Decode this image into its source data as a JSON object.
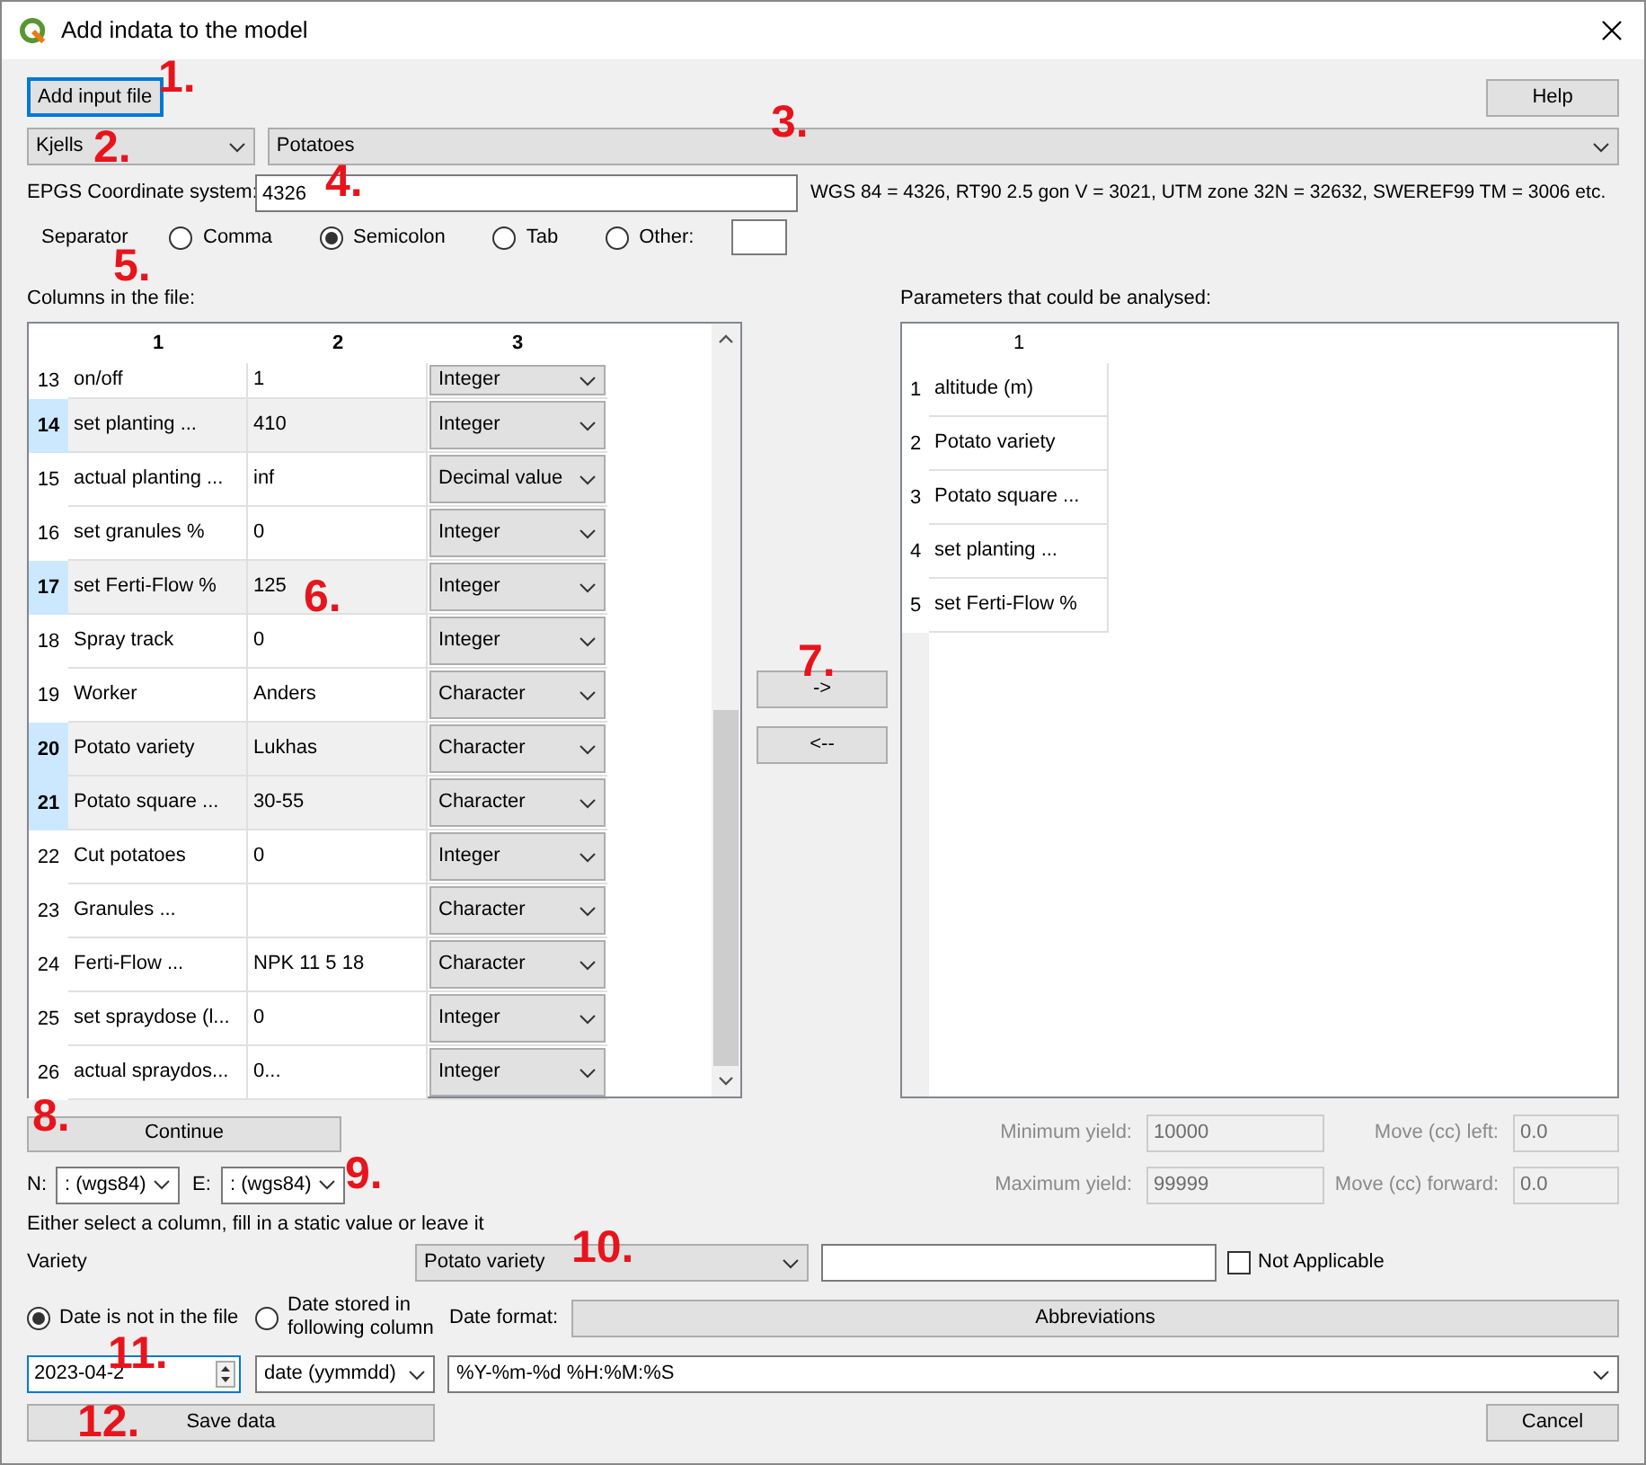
{
  "window": {
    "title": "Add indata to the model"
  },
  "toolbar": {
    "add_file_button": "Add input file",
    "help_button": "Help"
  },
  "selectors": {
    "farm": "Kjells",
    "crop": "Potatoes"
  },
  "coordinate_system": {
    "label": "EPGS Coordinate system:",
    "value": "4326",
    "hint": "WGS 84 = 4326, RT90 2.5 gon V = 3021, UTM zone 32N = 32632, SWEREF99 TM = 3006 etc."
  },
  "separator": {
    "label": "Separator",
    "options": [
      {
        "label": "Comma",
        "selected": false
      },
      {
        "label": "Semicolon",
        "selected": true
      },
      {
        "label": "Tab",
        "selected": false
      },
      {
        "label": "Other:",
        "selected": false
      }
    ]
  },
  "columns_table": {
    "title": "Columns in the file:",
    "columns": [
      "1",
      "2",
      "3"
    ],
    "rows": [
      {
        "number": "13",
        "name": "on/off",
        "value": "1",
        "type": "Integer",
        "selected": false
      },
      {
        "number": "14",
        "name": "set planting ...",
        "value": "410",
        "type": "Integer",
        "selected": true
      },
      {
        "number": "15",
        "name": "actual planting ...",
        "value": "inf",
        "type": "Decimal value",
        "selected": false
      },
      {
        "number": "16",
        "name": "set granules %",
        "value": "0",
        "type": "Integer",
        "selected": false
      },
      {
        "number": "17",
        "name": "set Ferti-Flow %",
        "value": "125",
        "type": "Integer",
        "selected": true
      },
      {
        "number": "18",
        "name": "Spray track",
        "value": "0",
        "type": "Integer",
        "selected": false
      },
      {
        "number": "19",
        "name": "Worker",
        "value": "Anders",
        "type": "Character",
        "selected": false
      },
      {
        "number": "20",
        "name": "Potato variety",
        "value": "Lukhas",
        "type": "Character",
        "selected": true
      },
      {
        "number": "21",
        "name": "Potato square ...",
        "value": "30-55",
        "type": "Character",
        "selected": true
      },
      {
        "number": "22",
        "name": "Cut potatoes",
        "value": "0",
        "type": "Integer",
        "selected": false
      },
      {
        "number": "23",
        "name": "Granules ...",
        "type": "Character",
        "selected": false
      },
      {
        "number": "24",
        "name": "Ferti-Flow ...",
        "value": "NPK 11 5 18",
        "type": "Character",
        "selected": false
      },
      {
        "number": "25",
        "name": "set spraydose (l...",
        "value": "0",
        "type": "Integer",
        "selected": false
      },
      {
        "number": "26",
        "name": "actual spraydos...",
        "value": "0...",
        "type": "Integer",
        "selected": false
      }
    ]
  },
  "move_buttons": [
    "->",
    "<--"
  ],
  "parameters_table": {
    "title": "Parameters that could be analysed:",
    "columns": [
      "1"
    ],
    "rows": [
      {
        "number": "1",
        "name": "altitude (m)"
      },
      {
        "number": "2",
        "name": "Potato variety"
      },
      {
        "number": "3",
        "name": "Potato square ..."
      },
      {
        "number": "4",
        "name": "set planting ..."
      },
      {
        "number": "5",
        "name": "set Ferti-Flow %"
      }
    ]
  },
  "continue_button": "Continue",
  "limits": [
    {
      "label": "Minimum yield:",
      "value": "10000",
      "disabled": true
    },
    {
      "label": "Move (cc) left:",
      "value": "0.0",
      "disabled": true
    },
    {
      "label": "Maximum yield:",
      "value": "99999",
      "disabled": true
    },
    {
      "label": "Move (cc) forward:",
      "value": "0.0",
      "disabled": true
    }
  ],
  "coordinates": [
    {
      "label": "N:",
      "value": ": (wgs84)"
    },
    {
      "label": "E:",
      "value": ": (wgs84)"
    }
  ],
  "static_hint": "Either select a column, fill in a static value or leave it",
  "variety": {
    "label": "Variety",
    "column": "Potato variety",
    "not_applicable": false,
    "checkbox_label": "Not Applicable"
  },
  "date": {
    "options": [
      {
        "label": "Date is not in the file",
        "selected": true
      },
      {
        "label": "Date stored in following column",
        "selected": false
      }
    ],
    "format_label": "Date format:",
    "abbreviations_button": "Abbreviations",
    "date_value": "2023-04-2",
    "date_type": "date (yymmdd)",
    "format": "%Y-%m-%d %H:%M:%S"
  },
  "save_button": "Save data",
  "cancel_button": "Cancel",
  "callouts": [
    "1.",
    "2.",
    "3.",
    "4.",
    "5.",
    "6.",
    "7.",
    "8.",
    "9.",
    "10.",
    "11.",
    "12."
  ]
}
